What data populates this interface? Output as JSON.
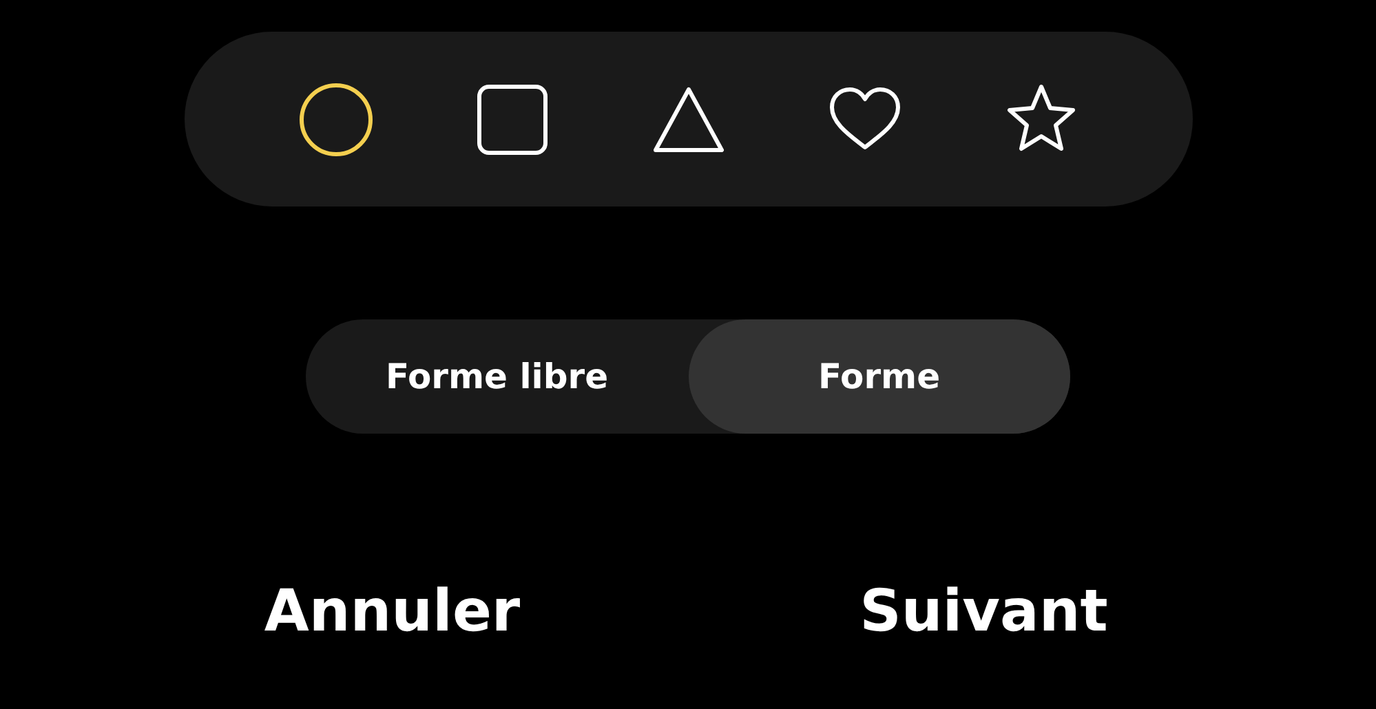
{
  "shapes": [
    {
      "kind": "circle",
      "selected": true
    },
    {
      "kind": "square",
      "selected": false
    },
    {
      "kind": "triangle",
      "selected": false
    },
    {
      "kind": "heart",
      "selected": false
    },
    {
      "kind": "star",
      "selected": false
    }
  ],
  "modes": [
    {
      "label": "Forme libre",
      "selected": false
    },
    {
      "label": "Forme",
      "selected": true
    }
  ],
  "buttons": [
    "Annuler",
    "Suivant"
  ]
}
